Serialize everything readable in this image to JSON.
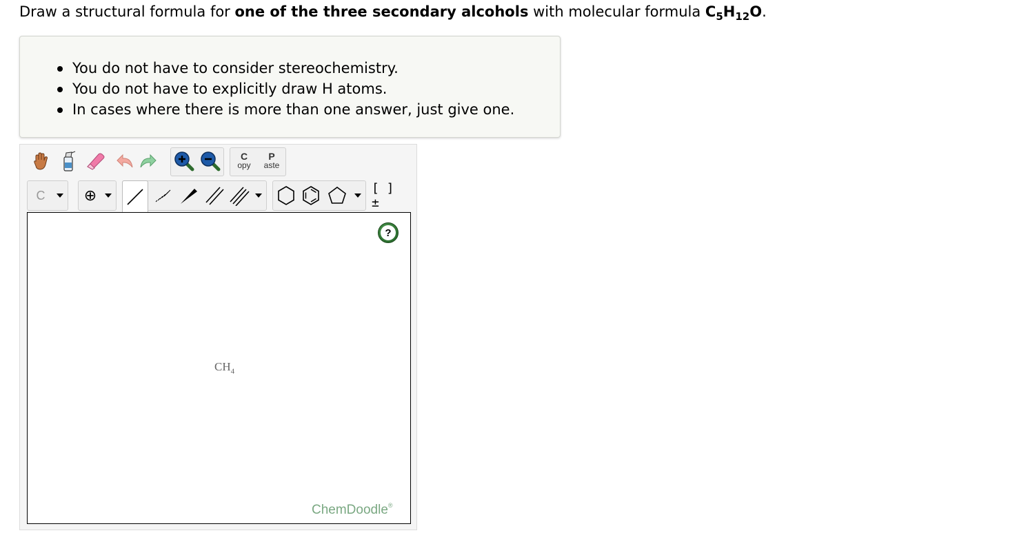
{
  "question": {
    "prefix": "Draw a structural formula for ",
    "bold": "one of the three secondary alcohols",
    "middle": " with molecular formula ",
    "formula_c": "C",
    "formula_c_sub": "5",
    "formula_h": "H",
    "formula_h_sub": "12",
    "formula_o": "O",
    "suffix": "."
  },
  "hints": [
    "You do not have to consider stereochemistry.",
    "You do not have to explicitly draw H atoms.",
    "In cases where there is more than one answer, just give one."
  ],
  "toolbar": {
    "copy_top": "C",
    "copy_bottom": "opy",
    "paste_top": "P",
    "paste_bottom": "aste",
    "atom_label": "C",
    "charge_label": "⊕",
    "bracket_label": "[ ]±"
  },
  "canvas": {
    "molecule_main": "CH",
    "molecule_sub": "4",
    "help_label": "?",
    "brand": "ChemDoodle",
    "brand_mark": "®"
  },
  "colors": {
    "hint_bg": "#f7f8f4",
    "brand": "#7aa882",
    "help_green": "#2e7d32"
  }
}
